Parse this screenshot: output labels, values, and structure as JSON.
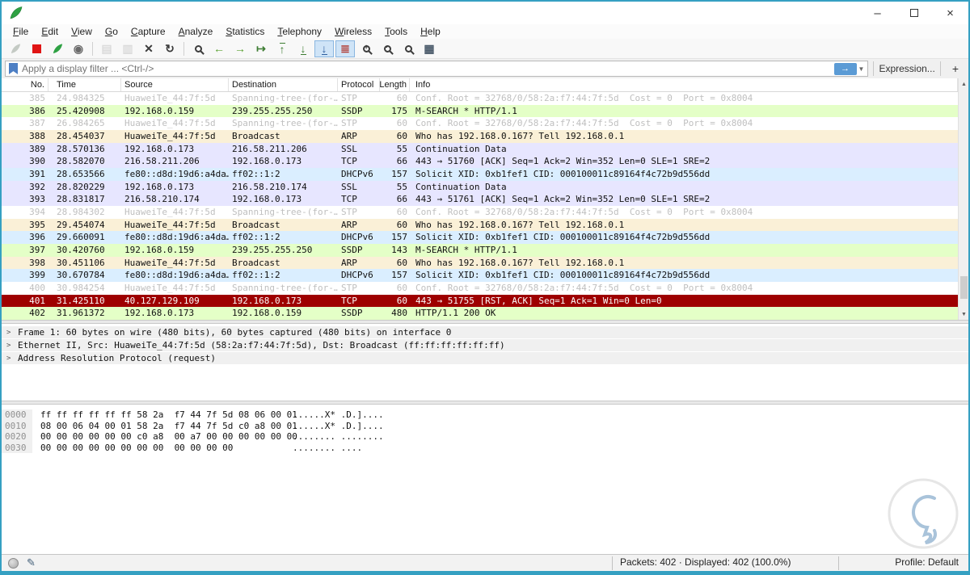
{
  "window": {
    "minimize": "–",
    "close": "×"
  },
  "menu": {
    "items": [
      "File",
      "Edit",
      "View",
      "Go",
      "Capture",
      "Analyze",
      "Statistics",
      "Telephony",
      "Wireless",
      "Tools",
      "Help"
    ]
  },
  "toolbar": {
    "items": [
      {
        "name": "start-capture-icon",
        "t": "fin",
        "c": "#9aa59a",
        "dis": true
      },
      {
        "name": "stop-capture-icon",
        "t": "sq",
        "c": "#e01414"
      },
      {
        "name": "restart-capture-icon",
        "t": "fin",
        "c": "#2ea143"
      },
      {
        "name": "capture-options-icon",
        "t": "txt",
        "g": "◉",
        "c": "#6a6a6a"
      },
      {
        "t": "sep"
      },
      {
        "name": "open-file-icon",
        "t": "txt",
        "g": "▤",
        "c": "#c4c4c4",
        "dis": true
      },
      {
        "name": "save-file-icon",
        "t": "txt",
        "g": "▥",
        "c": "#c4c4c4",
        "dis": true
      },
      {
        "name": "close-capture-icon",
        "t": "txt",
        "g": "✕",
        "c": "#3a3a3a"
      },
      {
        "name": "reload-icon",
        "t": "txt",
        "g": "↻",
        "c": "#3a3a3a"
      },
      {
        "t": "sep"
      },
      {
        "name": "find-packet-icon",
        "t": "mag",
        "g": ""
      },
      {
        "name": "go-back-icon",
        "t": "txt",
        "g": "←",
        "c": "#57a02e"
      },
      {
        "name": "go-forward-icon",
        "t": "txt",
        "g": "→",
        "c": "#57a02e"
      },
      {
        "name": "go-to-packet-icon",
        "t": "txt",
        "g": "↦",
        "c": "#3e7d33"
      },
      {
        "name": "go-to-top-icon",
        "t": "txt",
        "g": "↑",
        "c": "#3e7d33",
        "cls": "u-top"
      },
      {
        "name": "go-to-bottom-icon",
        "t": "txt",
        "g": "↓",
        "c": "#3e7d33",
        "cls": "u-bot"
      },
      {
        "name": "auto-scroll-icon",
        "t": "txt",
        "g": "↓",
        "c": "#2f5f9f",
        "cls": "u-bot",
        "hl": true
      },
      {
        "name": "colorize-icon",
        "t": "txt",
        "g": "≣",
        "c": "#b03830",
        "hl": true
      },
      {
        "name": "zoom-in-icon",
        "t": "mag",
        "g": "+"
      },
      {
        "name": "zoom-out-icon",
        "t": "mag",
        "g": "-"
      },
      {
        "name": "zoom-reset-icon",
        "t": "mag",
        "g": ""
      },
      {
        "name": "resize-columns-icon",
        "t": "txt",
        "g": "▦",
        "c": "#4a5a6a"
      }
    ]
  },
  "filter_bar": {
    "placeholder": "Apply a display filter ... <Ctrl-/>",
    "apply_glyph": "→",
    "caret": "▼",
    "expression_label": "Expression...",
    "add_label": "+"
  },
  "packet_list": {
    "columns": [
      "No.",
      "Time",
      "Source",
      "Destination",
      "Protocol",
      "Length",
      "Info"
    ],
    "rows": [
      {
        "no": "385",
        "time": "24.984325",
        "source": "HuaweiTe_44:7f:5d",
        "destination": "Spanning-tree-(for-…",
        "protocol": "STP",
        "length": "60",
        "info": "Conf. Root = 32768/0/58:2a:f7:44:7f:5d  Cost = 0  Port = 0x8004",
        "type": "stp"
      },
      {
        "no": "386",
        "time": "25.420908",
        "source": "192.168.0.159",
        "destination": "239.255.255.250",
        "protocol": "SSDP",
        "length": "175",
        "info": "M-SEARCH * HTTP/1.1",
        "type": "ssdp"
      },
      {
        "no": "387",
        "time": "26.984265",
        "source": "HuaweiTe_44:7f:5d",
        "destination": "Spanning-tree-(for-…",
        "protocol": "STP",
        "length": "60",
        "info": "Conf. Root = 32768/0/58:2a:f7:44:7f:5d  Cost = 0  Port = 0x8004",
        "type": "stp"
      },
      {
        "no": "388",
        "time": "28.454037",
        "source": "HuaweiTe_44:7f:5d",
        "destination": "Broadcast",
        "protocol": "ARP",
        "length": "60",
        "info": "Who has 192.168.0.167? Tell 192.168.0.1",
        "type": "arp"
      },
      {
        "no": "389",
        "time": "28.570136",
        "source": "192.168.0.173",
        "destination": "216.58.211.206",
        "protocol": "SSL",
        "length": "55",
        "info": "Continuation Data",
        "type": "tcp"
      },
      {
        "no": "390",
        "time": "28.582070",
        "source": "216.58.211.206",
        "destination": "192.168.0.173",
        "protocol": "TCP",
        "length": "66",
        "info": "443 → 51760 [ACK] Seq=1 Ack=2 Win=352 Len=0 SLE=1 SRE=2",
        "type": "tcp"
      },
      {
        "no": "391",
        "time": "28.653566",
        "source": "fe80::d8d:19d6:a4da…",
        "destination": "ff02::1:2",
        "protocol": "DHCPv6",
        "length": "157",
        "info": "Solicit XID: 0xb1fef1 CID: 000100011c89164f4c72b9d556dd",
        "type": "udp"
      },
      {
        "no": "392",
        "time": "28.820229",
        "source": "192.168.0.173",
        "destination": "216.58.210.174",
        "protocol": "SSL",
        "length": "55",
        "info": "Continuation Data",
        "type": "tcp"
      },
      {
        "no": "393",
        "time": "28.831817",
        "source": "216.58.210.174",
        "destination": "192.168.0.173",
        "protocol": "TCP",
        "length": "66",
        "info": "443 → 51761 [ACK] Seq=1 Ack=2 Win=352 Len=0 SLE=1 SRE=2",
        "type": "tcp"
      },
      {
        "no": "394",
        "time": "28.984302",
        "source": "HuaweiTe_44:7f:5d",
        "destination": "Spanning-tree-(for-…",
        "protocol": "STP",
        "length": "60",
        "info": "Conf. Root = 32768/0/58:2a:f7:44:7f:5d  Cost = 0  Port = 0x8004",
        "type": "stp"
      },
      {
        "no": "395",
        "time": "29.454074",
        "source": "HuaweiTe_44:7f:5d",
        "destination": "Broadcast",
        "protocol": "ARP",
        "length": "60",
        "info": "Who has 192.168.0.167? Tell 192.168.0.1",
        "type": "arp"
      },
      {
        "no": "396",
        "time": "29.660091",
        "source": "fe80::d8d:19d6:a4da…",
        "destination": "ff02::1:2",
        "protocol": "DHCPv6",
        "length": "157",
        "info": "Solicit XID: 0xb1fef1 CID: 000100011c89164f4c72b9d556dd",
        "type": "udp"
      },
      {
        "no": "397",
        "time": "30.420760",
        "source": "192.168.0.159",
        "destination": "239.255.255.250",
        "protocol": "SSDP",
        "length": "143",
        "info": "M-SEARCH * HTTP/1.1",
        "type": "ssdp"
      },
      {
        "no": "398",
        "time": "30.451106",
        "source": "HuaweiTe_44:7f:5d",
        "destination": "Broadcast",
        "protocol": "ARP",
        "length": "60",
        "info": "Who has 192.168.0.167? Tell 192.168.0.1",
        "type": "arp"
      },
      {
        "no": "399",
        "time": "30.670784",
        "source": "fe80::d8d:19d6:a4da…",
        "destination": "ff02::1:2",
        "protocol": "DHCPv6",
        "length": "157",
        "info": "Solicit XID: 0xb1fef1 CID: 000100011c89164f4c72b9d556dd",
        "type": "udp"
      },
      {
        "no": "400",
        "time": "30.984254",
        "source": "HuaweiTe_44:7f:5d",
        "destination": "Spanning-tree-(for-…",
        "protocol": "STP",
        "length": "60",
        "info": "Conf. Root = 32768/0/58:2a:f7:44:7f:5d  Cost = 0  Port = 0x8004",
        "type": "stp"
      },
      {
        "no": "401",
        "time": "31.425110",
        "source": "40.127.129.109",
        "destination": "192.168.0.173",
        "protocol": "TCP",
        "length": "60",
        "info": "443 → 51755 [RST, ACK] Seq=1 Ack=1 Win=0 Len=0",
        "type": "bad"
      },
      {
        "no": "402",
        "time": "31.961372",
        "source": "192.168.0.173",
        "destination": "192.168.0.159",
        "protocol": "SSDP",
        "length": "480",
        "info": "HTTP/1.1 200 OK",
        "type": "ssdp"
      }
    ]
  },
  "details": {
    "rows": [
      "Frame 1: 60 bytes on wire (480 bits), 60 bytes captured (480 bits) on interface 0",
      "Ethernet II, Src: HuaweiTe_44:7f:5d (58:2a:f7:44:7f:5d), Dst: Broadcast (ff:ff:ff:ff:ff:ff)",
      "Address Resolution Protocol (request)"
    ]
  },
  "hex": {
    "rows": [
      {
        "offset": "0000",
        "bytes": "ff ff ff ff ff ff 58 2a  f7 44 7f 5d 08 06 00 01",
        "ascii": "......X* .D.]...."
      },
      {
        "offset": "0010",
        "bytes": "08 00 06 04 00 01 58 2a  f7 44 7f 5d c0 a8 00 01",
        "ascii": "......X* .D.]...."
      },
      {
        "offset": "0020",
        "bytes": "00 00 00 00 00 00 c0 a8  00 a7 00 00 00 00 00 00",
        "ascii": "........ ........"
      },
      {
        "offset": "0030",
        "bytes": "00 00 00 00 00 00 00 00  00 00 00 00",
        "ascii": "........ ...."
      }
    ]
  },
  "status_bar": {
    "packets_text": "Packets: 402 · Displayed: 402 (100.0%)",
    "profile_text": "Profile: Default"
  },
  "colors": {
    "window_border": "#35a0c2",
    "row_ssdp": "#e4ffc7",
    "row_arp": "#faf0d7",
    "row_tcp": "#e7e6ff",
    "row_udp": "#daeeff",
    "row_bad_bg": "#9e0000",
    "highlight_btn": "#cfe4f7",
    "apply_btn": "#5b9bd5"
  }
}
